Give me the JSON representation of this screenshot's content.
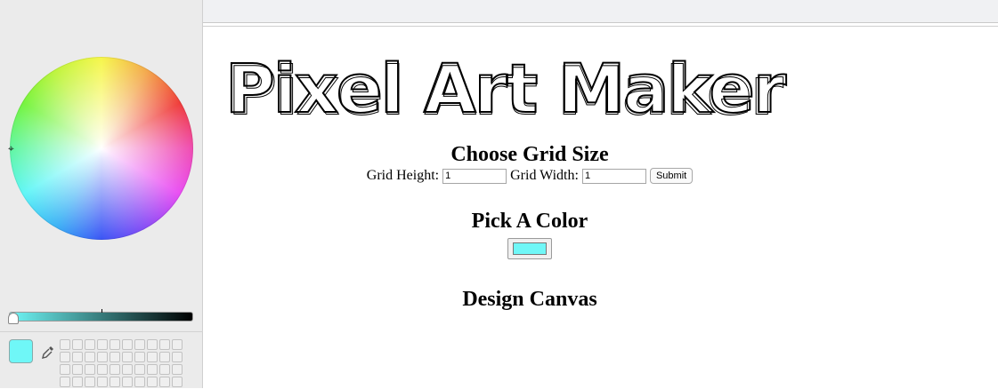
{
  "picker": {
    "current_color": "#6ff7f7",
    "brightness_track_end": "#000000",
    "icons": {
      "eyedropper": "eyedropper-icon",
      "wheel_handle": "crosshair-icon"
    }
  },
  "page": {
    "logo_text": "Pixel Art Maker",
    "grid_section": {
      "heading": "Choose Grid Size",
      "height_label": "Grid Height:",
      "height_value": "1",
      "width_label": "Grid Width:",
      "width_value": "1",
      "submit_label": "Submit"
    },
    "color_section": {
      "heading": "Pick A Color",
      "value": "#6ff7f7"
    },
    "canvas_section": {
      "heading": "Design Canvas"
    }
  }
}
